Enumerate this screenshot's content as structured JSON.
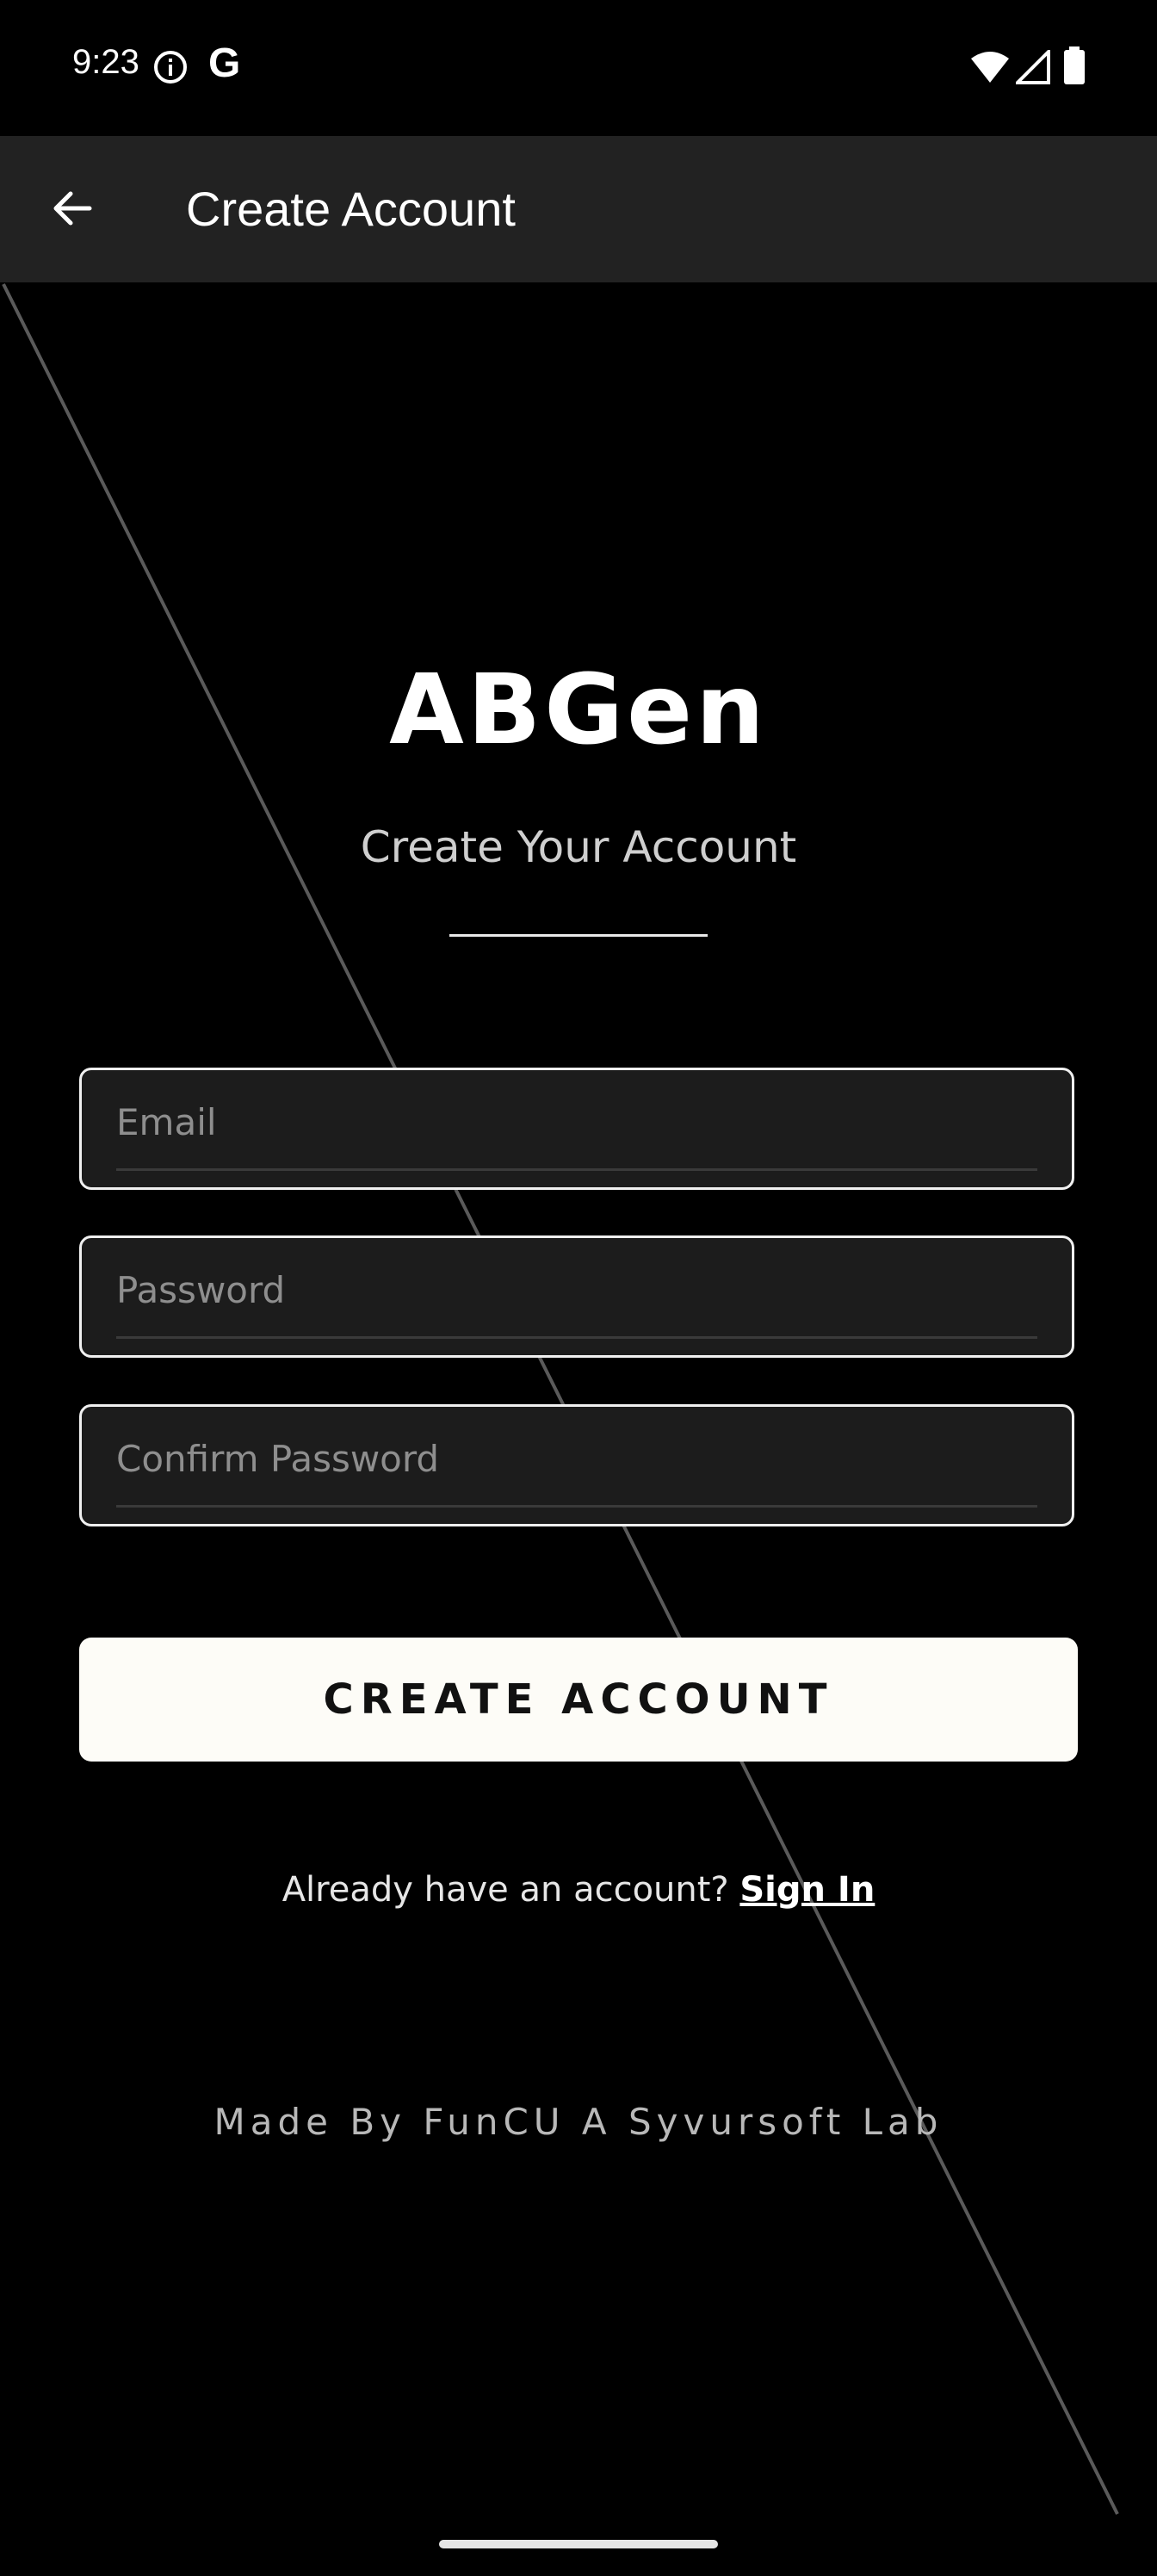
{
  "status_bar": {
    "time": "9:23",
    "info_icon": "info-circle-icon",
    "g_icon": "G",
    "wifi_icon": "wifi-icon",
    "signal_icon": "signal-icon",
    "battery_icon": "battery-icon"
  },
  "app_bar": {
    "back_icon": "arrow-left-icon",
    "title": "Create Account"
  },
  "brand": {
    "name": "ABGen",
    "subtitle": "Create Your Account"
  },
  "form": {
    "email_placeholder": "Email",
    "password_placeholder": "Password",
    "confirm_password_placeholder": "Confirm Password",
    "submit_label": "CREATE ACCOUNT"
  },
  "signin": {
    "prompt": "Already have an account?",
    "link_label": "Sign In"
  },
  "footer": {
    "text": "Made By FunCU A Syvursoft Lab"
  },
  "colors": {
    "background": "#000000",
    "app_bar": "#222222",
    "field_background": "#1c1c1c",
    "button_background": "#fdfcf7"
  }
}
